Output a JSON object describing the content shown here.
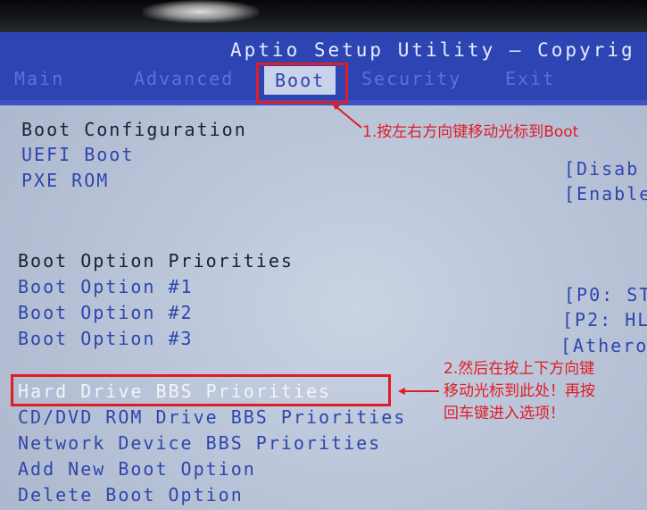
{
  "app_title": "Aptio Setup Utility – Copyrig",
  "menu": {
    "items": [
      {
        "label": "Main"
      },
      {
        "label": "Advanced"
      },
      {
        "label": "Boot"
      },
      {
        "label": "Security"
      },
      {
        "label": "Exit"
      }
    ],
    "active": "Boot"
  },
  "boot_configuration": {
    "heading": "Boot Configuration",
    "items": [
      {
        "label": "UEFI Boot",
        "value": "[Disab"
      },
      {
        "label": "PXE ROM",
        "value": "[Enable"
      }
    ]
  },
  "boot_priorities": {
    "heading": "Boot Option Priorities",
    "items": [
      {
        "label": "Boot Option #1",
        "value": "[P0: ST"
      },
      {
        "label": "Boot Option #2",
        "value": "[P2: HL"
      },
      {
        "label": "Boot Option #3",
        "value": "[Athero"
      }
    ]
  },
  "submenus": [
    {
      "label": "Hard Drive BBS Priorities",
      "selected": true
    },
    {
      "label": "CD/DVD ROM Drive BBS Priorities"
    },
    {
      "label": "Network Device BBS Priorities"
    },
    {
      "label": "Add New Boot Option"
    },
    {
      "label": "Delete Boot Option"
    }
  ],
  "annotations": {
    "step1": "1.按左右方向键移动光标到Boot",
    "step2_line1": "2.然后在按上下方向键",
    "step2_line2": "移动光标到此处！再按",
    "step2_line3": "回车键进入选项！"
  },
  "colors": {
    "annotation": "#e01c24",
    "bios_blue": "#2d44b3",
    "screen_bg": "#c1cbe0"
  }
}
